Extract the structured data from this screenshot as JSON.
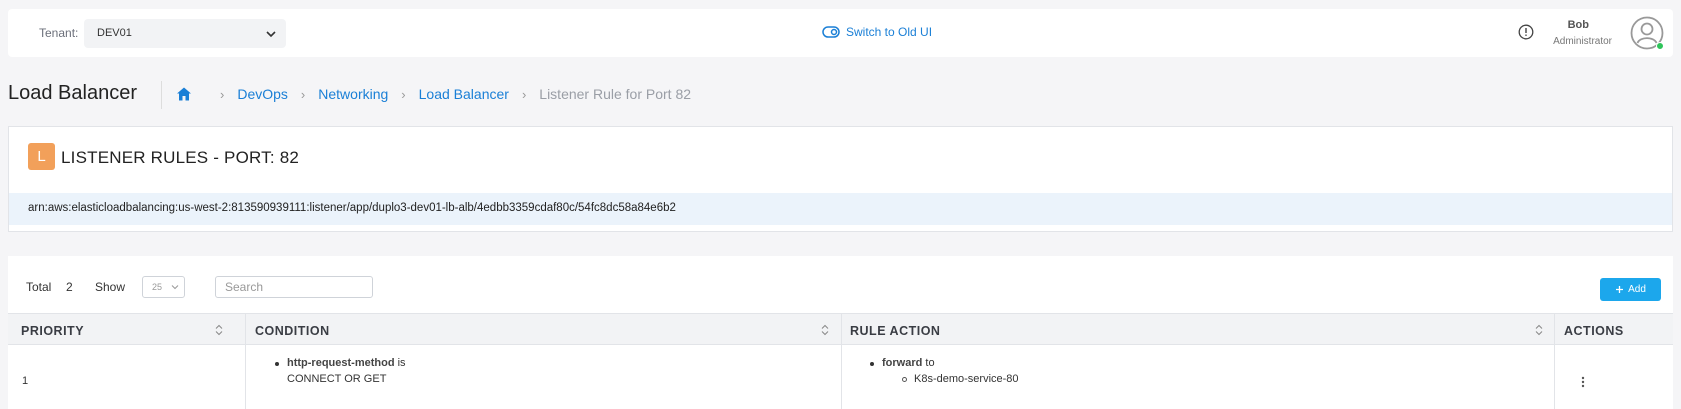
{
  "header": {
    "tenant_label": "Tenant:",
    "tenant_value": "DEV01",
    "switch_ui_label": "Switch to Old UI",
    "user_name": "Bob",
    "user_role": "Administrator",
    "icons": [
      "chevron-down-icon",
      "toggle-icon",
      "info-icon",
      "avatar-icon"
    ]
  },
  "page": {
    "title": "Load Balancer",
    "breadcrumb": [
      {
        "label": "DevOps"
      },
      {
        "label": "Networking"
      },
      {
        "label": "Load Balancer"
      },
      {
        "label": "Listener Rule for Port 82"
      }
    ]
  },
  "card": {
    "badge_letter": "L",
    "heading": "LISTENER RULES - PORT: 82",
    "arn": "arn:aws:elasticloadbalancing:us-west-2:813590939111:listener/app/duplo3-dev01-lb-alb/4edbb3359cdaf80c/54fc8dc58a84e6b2"
  },
  "table": {
    "total_label": "Total",
    "total_value": "2",
    "show_label": "Show",
    "page_size": "25",
    "search_placeholder": "Search",
    "add_label": "Add",
    "columns": [
      "PRIORITY",
      "CONDITION",
      "RULE ACTION",
      "ACTIONS"
    ],
    "rows": [
      {
        "priority": "1",
        "condition_field": "http-request-method",
        "condition_op": "is",
        "condition_value": "CONNECT OR GET",
        "action_type": "forward",
        "action_prep": "to",
        "action_target": "K8s-demo-service-80"
      }
    ]
  },
  "colors": {
    "accent": "#1a7fd6",
    "add_button": "#1ca7ec",
    "badge": "#f2a05a",
    "arn_band": "#ebf3fb",
    "online": "#2ec45a"
  }
}
